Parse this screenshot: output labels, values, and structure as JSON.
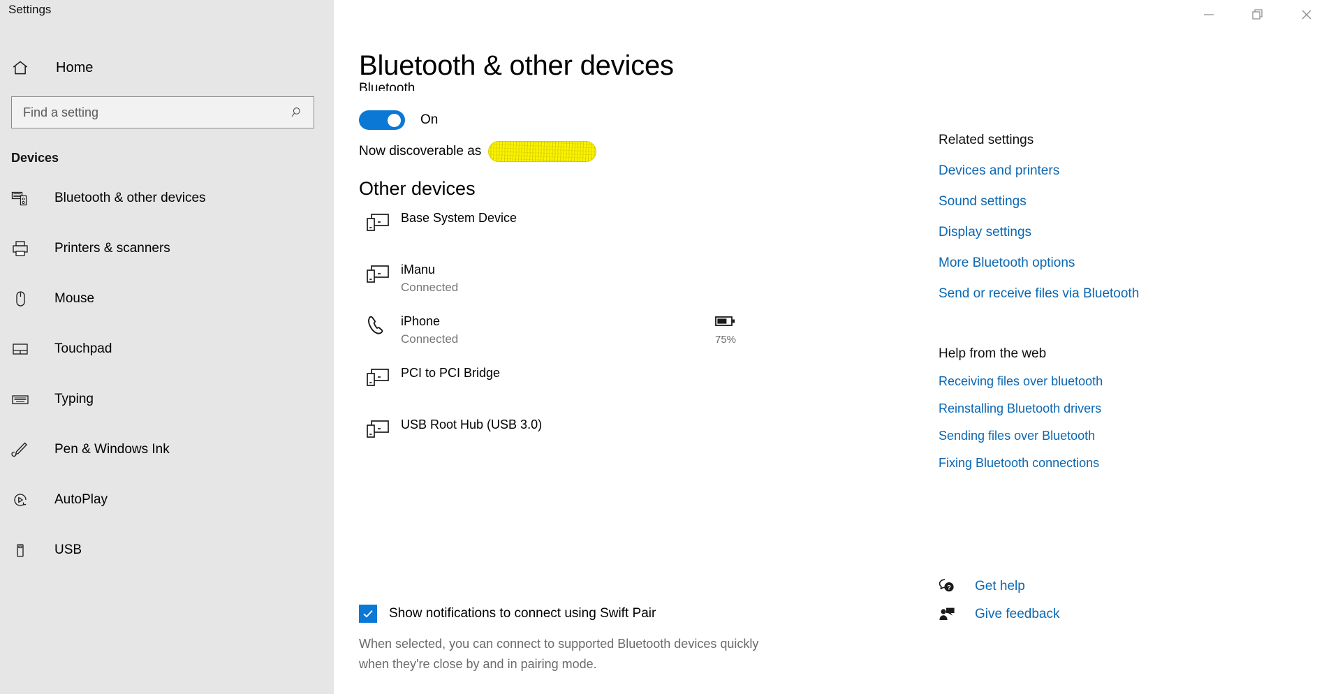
{
  "window": {
    "title": "Settings",
    "controls": [
      {
        "name": "minimize",
        "label": "Minimize"
      },
      {
        "name": "restore",
        "label": "Restore"
      },
      {
        "name": "close",
        "label": "Close"
      }
    ]
  },
  "sidebar": {
    "home": {
      "label": "Home",
      "icon": "home-icon"
    },
    "search": {
      "value": "",
      "placeholder": "Find a setting",
      "icon": "search-icon"
    },
    "group_title": "Devices",
    "items": [
      {
        "label": "Bluetooth & other devices",
        "icon": "bluetooth-devices-icon",
        "selected": true
      },
      {
        "label": "Printers & scanners",
        "icon": "printer-icon",
        "selected": false
      },
      {
        "label": "Mouse",
        "icon": "mouse-icon",
        "selected": false
      },
      {
        "label": "Touchpad",
        "icon": "touchpad-icon",
        "selected": false
      },
      {
        "label": "Typing",
        "icon": "keyboard-icon",
        "selected": false
      },
      {
        "label": "Pen & Windows Ink",
        "icon": "pen-icon",
        "selected": false
      },
      {
        "label": "AutoPlay",
        "icon": "autoplay-icon",
        "selected": false
      },
      {
        "label": "USB",
        "icon": "usb-icon",
        "selected": false
      }
    ]
  },
  "main": {
    "page_title": "Bluetooth & other devices",
    "bluetooth_label": "Bluetooth",
    "toggle": {
      "state_label": "On",
      "on": true
    },
    "discoverable": {
      "prefix": "Now discoverable as",
      "value_redacted": true
    },
    "other_devices_heading": "Other devices",
    "devices": [
      {
        "name": "Base System Device",
        "status": "",
        "icon": "generic-device-icon",
        "battery": ""
      },
      {
        "name": "iManu",
        "status": "Connected",
        "icon": "generic-device-icon",
        "battery": ""
      },
      {
        "name": "iPhone",
        "status": "Connected",
        "icon": "phone-icon",
        "battery": "75%"
      },
      {
        "name": "PCI to PCI Bridge",
        "status": "",
        "icon": "generic-device-icon",
        "battery": ""
      },
      {
        "name": "USB Root Hub (USB 3.0)",
        "status": "",
        "icon": "generic-device-icon",
        "battery": ""
      }
    ],
    "swift_pair": {
      "checked": true,
      "label": "Show notifications to connect using Swift Pair",
      "description": "When selected, you can connect to supported Bluetooth devices quickly when they're close by and in pairing mode."
    }
  },
  "rail": {
    "related_settings_heading": "Related settings",
    "related_links": [
      "Devices and printers",
      "Sound settings",
      "Display settings",
      "More Bluetooth options",
      "Send or receive files via Bluetooth"
    ],
    "help_heading": "Help from the web",
    "help_links": [
      "Receiving files over bluetooth",
      "Reinstalling Bluetooth drivers",
      "Sending files over Bluetooth",
      "Fixing Bluetooth connections"
    ],
    "footer": [
      {
        "label": "Get help",
        "icon": "help-bubble-icon"
      },
      {
        "label": "Give feedback",
        "icon": "feedback-person-icon"
      }
    ]
  },
  "colors": {
    "accent": "#0a78d4",
    "link": "#0b67b2",
    "sidebar_bg": "#e6e6e6",
    "muted_text": "#767676",
    "redaction": "#fbf400"
  }
}
